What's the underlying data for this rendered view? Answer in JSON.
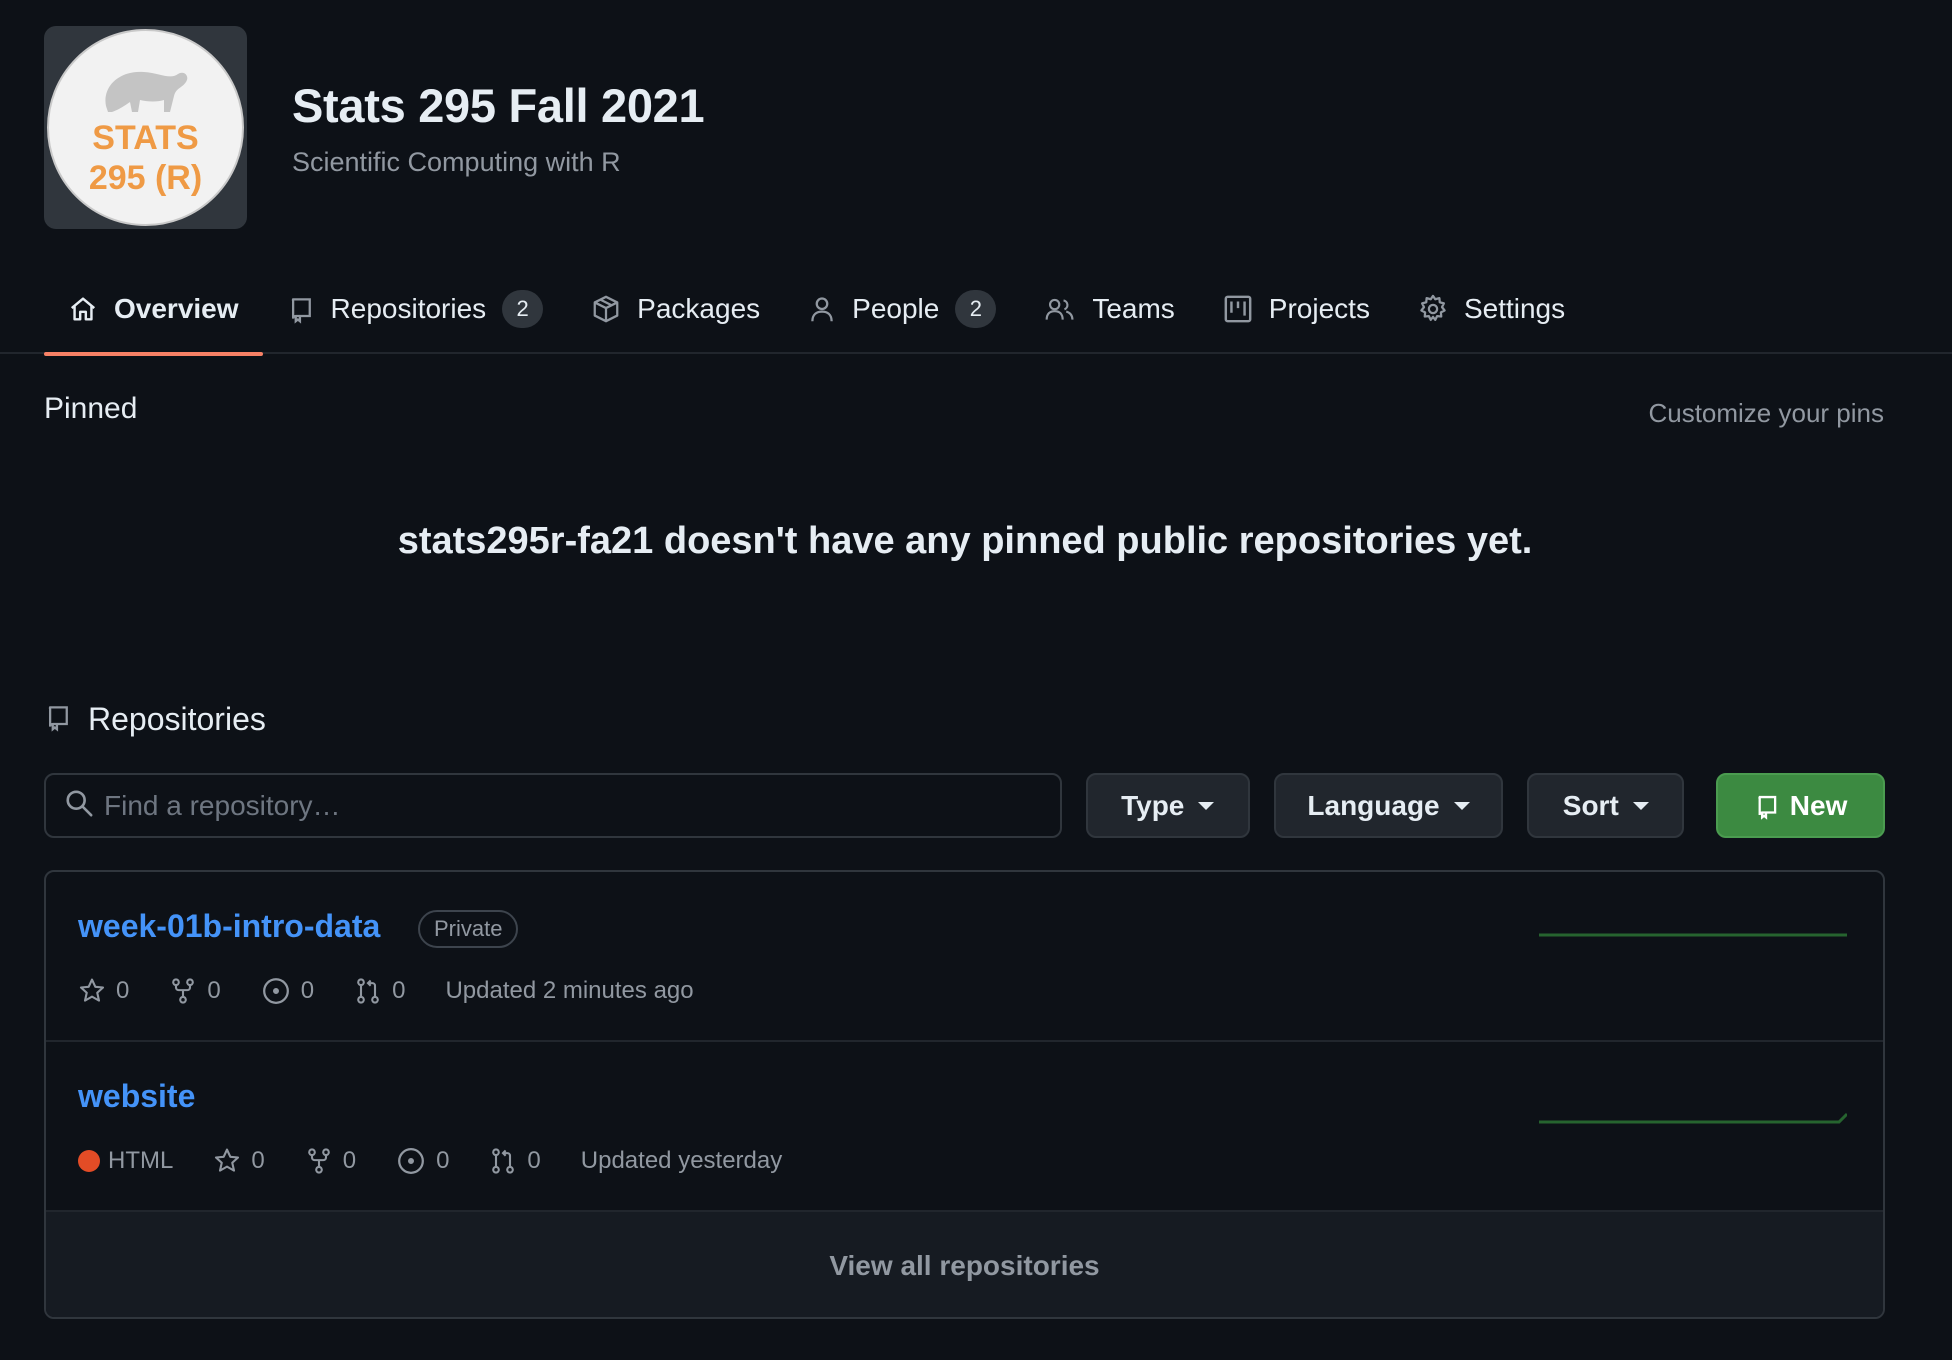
{
  "org": {
    "avatar_text_line1": "STATS",
    "avatar_text_line2": "295 (R)",
    "title": "Stats 295 Fall 2021",
    "description": "Scientific Computing with R"
  },
  "tabs": [
    {
      "label": "Overview",
      "icon": "home-icon",
      "active": true
    },
    {
      "label": "Repositories",
      "icon": "repo-icon",
      "count": "2"
    },
    {
      "label": "Packages",
      "icon": "package-icon"
    },
    {
      "label": "People",
      "icon": "person-icon",
      "count": "2"
    },
    {
      "label": "Teams",
      "icon": "people-icon"
    },
    {
      "label": "Projects",
      "icon": "project-icon"
    },
    {
      "label": "Settings",
      "icon": "gear-icon"
    }
  ],
  "pinned": {
    "label": "Pinned",
    "customize": "Customize your pins",
    "empty_message": "stats295r-fa21 doesn't have any pinned public repositories yet."
  },
  "repositories": {
    "heading": "Repositories",
    "search_placeholder": "Find a repository…",
    "type_label": "Type",
    "language_label": "Language",
    "sort_label": "Sort",
    "new_label": "New",
    "items": [
      {
        "name": "week-01b-intro-data",
        "badge": "Private",
        "stars": "0",
        "forks": "0",
        "issues": "0",
        "pulls": "0",
        "updated": "Updated 2 minutes ago"
      },
      {
        "name": "website",
        "language": "HTML",
        "stars": "0",
        "forks": "0",
        "issues": "0",
        "pulls": "0",
        "updated": "Updated yesterday"
      }
    ],
    "view_all": "View all repositories"
  },
  "colors": {
    "background": "#0d1117",
    "link": "#4493f8",
    "accent_underline": "#f78166",
    "new_button": "#3c8a41",
    "html_language": "#e34c26",
    "avatar_text": "#ef9a45"
  }
}
